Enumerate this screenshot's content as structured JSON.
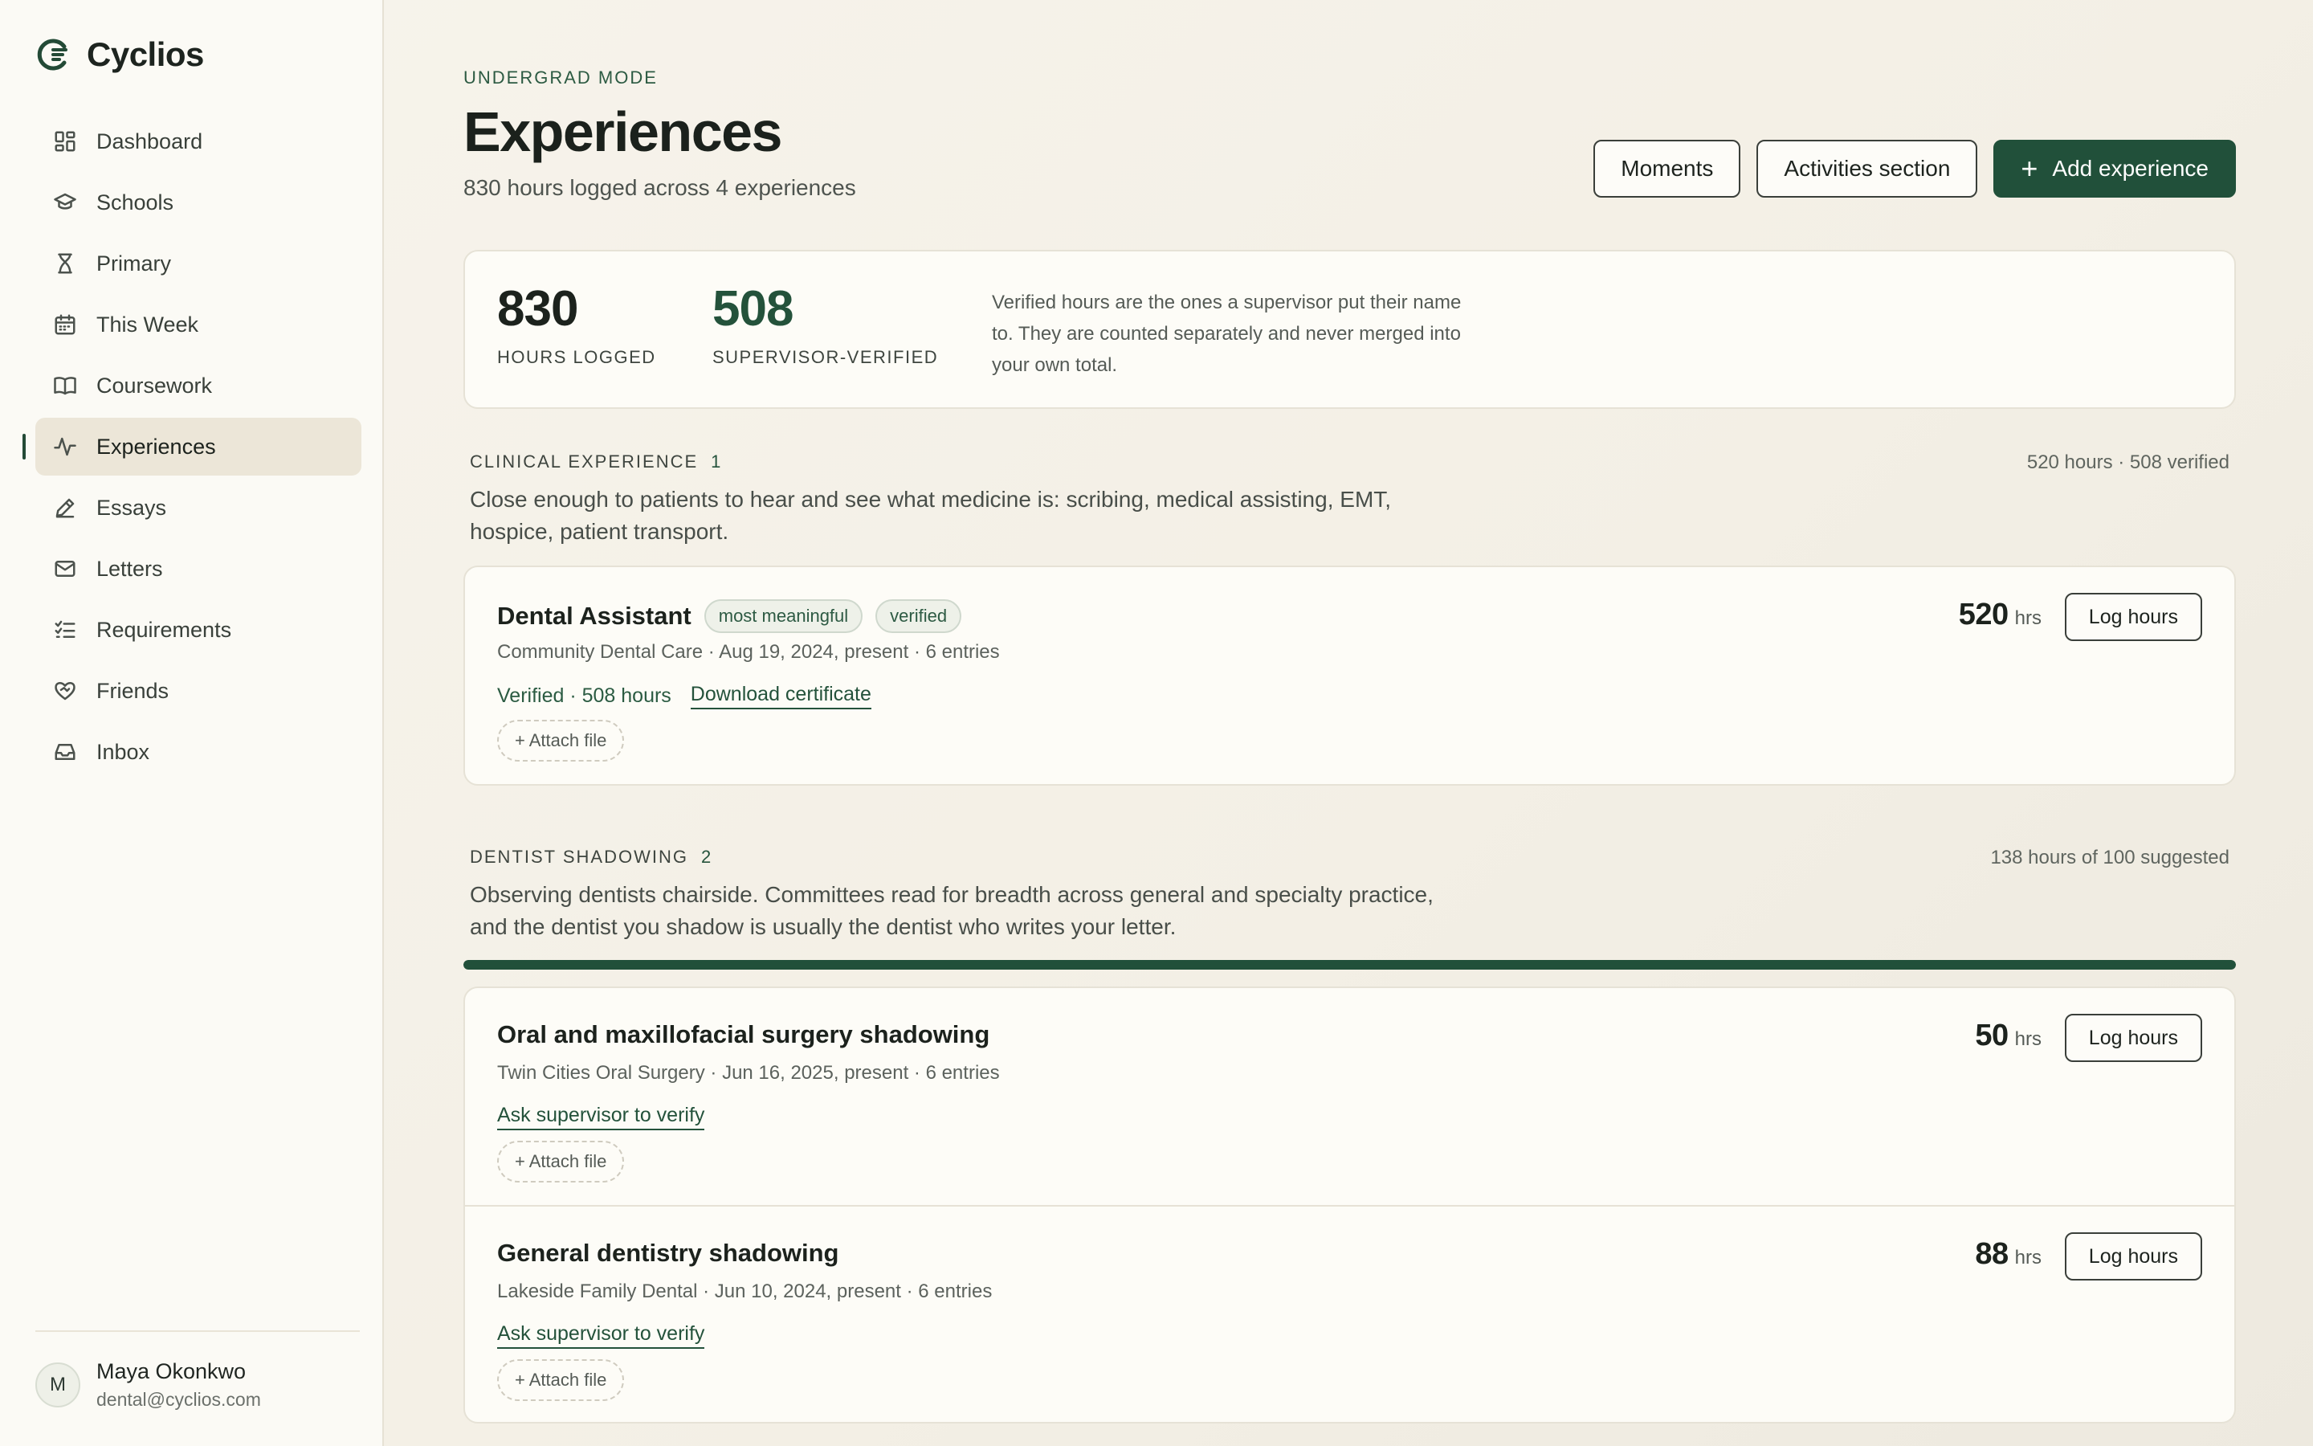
{
  "app": {
    "name": "Cyclios"
  },
  "sidebar": {
    "items": [
      {
        "label": "Dashboard",
        "icon": "dashboard-icon"
      },
      {
        "label": "Schools",
        "icon": "graduation-cap-icon"
      },
      {
        "label": "Primary",
        "icon": "hourglass-icon"
      },
      {
        "label": "This Week",
        "icon": "calendar-icon"
      },
      {
        "label": "Coursework",
        "icon": "book-icon"
      },
      {
        "label": "Experiences",
        "icon": "activity-icon",
        "active": true
      },
      {
        "label": "Essays",
        "icon": "pen-icon"
      },
      {
        "label": "Letters",
        "icon": "mail-icon"
      },
      {
        "label": "Requirements",
        "icon": "checklist-icon"
      },
      {
        "label": "Friends",
        "icon": "heart-handshake-icon"
      },
      {
        "label": "Inbox",
        "icon": "inbox-icon"
      }
    ],
    "user": {
      "initial": "M",
      "name": "Maya Okonkwo",
      "email": "dental@cyclios.com"
    }
  },
  "header": {
    "mode": "UNDERGRAD MODE",
    "title": "Experiences",
    "subtitle": "830 hours logged across 4 experiences",
    "buttons": {
      "moments": "Moments",
      "activities": "Activities section",
      "add": "Add experience"
    }
  },
  "stats": {
    "hours_logged": {
      "value": "830",
      "label": "HOURS LOGGED"
    },
    "verified": {
      "value": "508",
      "label": "SUPERVISOR-VERIFIED"
    },
    "note": "Verified hours are the ones a supervisor put their name to. They are counted separately and never merged into your own total."
  },
  "sections": [
    {
      "label": "CLINICAL EXPERIENCE",
      "count": "1",
      "meta": "520 hours · 508 verified",
      "description": "Close enough to patients to hear and see what medicine is: scribing, medical assisting, EMT, hospice, patient transport.",
      "experiences": [
        {
          "title": "Dental Assistant",
          "pills": [
            "most meaningful",
            "verified"
          ],
          "meta": "Community Dental Care · Aug 19, 2024, present · 6 entries",
          "verified_text": "Verified · 508 hours",
          "link": "Download certificate",
          "attach": "+ Attach file",
          "hours": "520",
          "unit": "hrs",
          "log_label": "Log hours"
        }
      ]
    },
    {
      "label": "DENTIST SHADOWING",
      "count": "2",
      "meta": "138 hours of 100 suggested",
      "progress": 1.0,
      "description": "Observing dentists chairside. Committees read for breadth across general and specialty practice, and the dentist you shadow is usually the dentist who writes your letter.",
      "experiences": [
        {
          "title": "Oral and maxillofacial surgery shadowing",
          "meta": "Twin Cities Oral Surgery · Jun 16, 2025, present · 6 entries",
          "link": "Ask supervisor to verify",
          "attach": "+ Attach file",
          "hours": "50",
          "unit": "hrs",
          "log_label": "Log hours"
        },
        {
          "title": "General dentistry shadowing",
          "meta": "Lakeside Family Dental · Jun 10, 2024, present · 6 entries",
          "link": "Ask supervisor to verify",
          "attach": "+ Attach file",
          "hours": "88",
          "unit": "hrs",
          "log_label": "Log hours"
        }
      ]
    }
  ],
  "colors": {
    "accent": "#21503a",
    "background": "#f5f2ea",
    "sidebar": "#fbfaf5"
  }
}
